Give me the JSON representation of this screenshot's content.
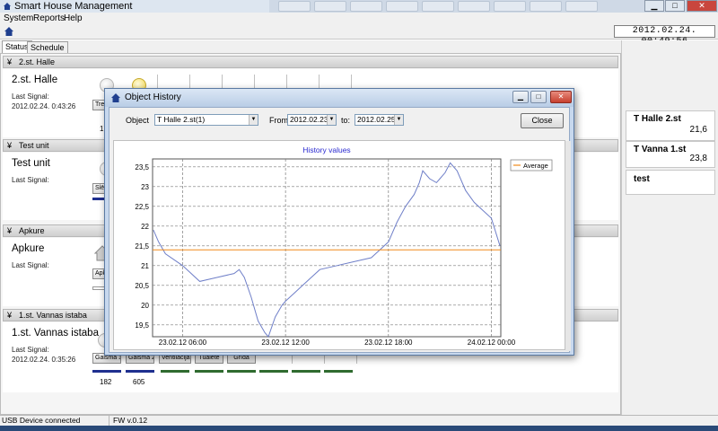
{
  "window": {
    "title": "Smart House Management",
    "controls": {
      "minimize": "▁",
      "maximize": "□",
      "close": "✕"
    }
  },
  "menu": [
    "System",
    "Reports",
    "Help"
  ],
  "toolbar": {
    "datetime": "2012.02.24.   00:49:56"
  },
  "tabs": [
    "Status",
    "Schedule"
  ],
  "sections": [
    {
      "header": "2.st. Halle",
      "title": "2.st. Halle",
      "last_signal_label": "Last Signal:",
      "last_signal_value": "2012.02.24. 0:43:26",
      "device_button": "Trep",
      "device_value": "173"
    },
    {
      "header": "Test unit",
      "title": "Test unit",
      "last_signal_label": "Last Signal:",
      "last_signal_value": "",
      "device_button": "Slēd"
    },
    {
      "header": "Apkure",
      "title": "Apkure",
      "last_signal_label": "Last Signal:",
      "last_signal_value": "",
      "device_button": "Apkur"
    },
    {
      "header": "1.st. Vannas istaba",
      "title": "1.st. Vannas istaba",
      "last_signal_label": "Last Signal:",
      "last_signal_value": "2012.02.24. 0:35:26",
      "devices": [
        {
          "label": "Gaisma 1",
          "value": "182",
          "bar_color": "#1f2f8f"
        },
        {
          "label": "Gaisma 2",
          "value": "605",
          "bar_color": "#1f2f8f"
        },
        {
          "label": "Ventilācija",
          "value": "",
          "bar_color": "#2f6b2f"
        },
        {
          "label": "Tualete",
          "value": "",
          "bar_color": "#2f6b2f"
        },
        {
          "label": "Grīda",
          "value": "",
          "bar_color": "#2f6b2f"
        }
      ]
    }
  ],
  "right_panel": [
    {
      "name": "T Halle 2.st",
      "value": "21,6"
    },
    {
      "name": "T Vanna 1.st",
      "value": "23,8"
    },
    {
      "name": "test",
      "value": ""
    }
  ],
  "status_bar": {
    "usb": "USB Device connected",
    "fw": "FW v.0.12"
  },
  "dialog": {
    "title": "Object History",
    "object_label": "Object",
    "object_value": "T Halle 2.st(1)",
    "from_label": "From:",
    "from_value": "2012.02.23.",
    "to_label": "to:",
    "to_value": "2012.02.25.",
    "close_button": "Close"
  },
  "chart_data": {
    "type": "line",
    "title": "History values",
    "legend": [
      "Average"
    ],
    "legend_position": "top-right",
    "grid": true,
    "x_unit": "hours",
    "xlim": [
      4.25,
      24.55
    ],
    "ylim": [
      19.2,
      23.7
    ],
    "x_ticks": [
      {
        "x": 6,
        "label": "23.02.12 06:00"
      },
      {
        "x": 12,
        "label": "23.02.12 12:00"
      },
      {
        "x": 18,
        "label": "23.02.12 18:00"
      },
      {
        "x": 24,
        "label": "24.02.12 00:00"
      }
    ],
    "y_ticks": [
      19.5,
      20,
      20.5,
      21,
      21.5,
      22,
      22.5,
      23,
      23.5
    ],
    "y_tick_labels": [
      "19,5",
      "20",
      "20,5",
      "21",
      "21,5",
      "22",
      "22,5",
      "23",
      "23,5"
    ],
    "series": [
      {
        "name": "",
        "color": "#6f7fc8",
        "x": [
          4.3,
          4.6,
          5.0,
          6.0,
          7.0,
          8.0,
          9.0,
          9.3,
          9.6,
          10.0,
          10.4,
          10.8,
          11.0,
          11.4,
          11.8,
          12.0,
          12.5,
          13.0,
          14.0,
          15.0,
          16.0,
          17.0,
          17.5,
          18.0,
          18.5,
          19.0,
          19.5,
          19.8,
          20.0,
          20.4,
          20.8,
          21.0,
          21.3,
          21.6,
          22.0,
          22.5,
          23.0,
          23.5,
          24.0,
          24.5
        ],
        "y": [
          21.9,
          21.6,
          21.3,
          21.0,
          20.6,
          20.7,
          20.8,
          20.9,
          20.7,
          20.2,
          19.6,
          19.3,
          19.2,
          19.7,
          20.0,
          20.1,
          20.3,
          20.5,
          20.9,
          21.0,
          21.1,
          21.2,
          21.4,
          21.6,
          22.1,
          22.5,
          22.8,
          23.1,
          23.4,
          23.2,
          23.1,
          23.2,
          23.35,
          23.6,
          23.4,
          22.9,
          22.6,
          22.4,
          22.2,
          21.5
        ]
      },
      {
        "name": "Average",
        "color": "#f08a1a",
        "x": [
          4.25,
          24.55
        ],
        "y": [
          21.4,
          21.4
        ]
      }
    ]
  },
  "colors": {
    "series_line": "#6f7fc8",
    "average_line": "#f08a1a",
    "title_text": "#2a2ad0"
  }
}
